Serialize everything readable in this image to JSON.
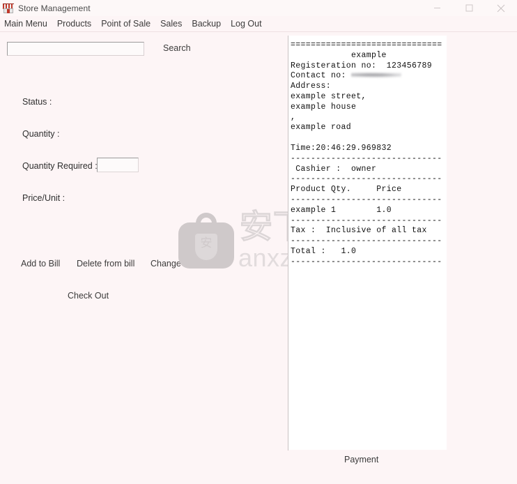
{
  "window": {
    "title": "Store Management",
    "icon": "store-icon",
    "controls": {
      "minimize": "minimize-icon",
      "maximize": "maximize-icon",
      "close": "close-icon"
    }
  },
  "menubar": {
    "items": [
      {
        "label": "Main Menu"
      },
      {
        "label": "Products"
      },
      {
        "label": "Point of Sale"
      },
      {
        "label": "Sales"
      },
      {
        "label": "Backup"
      },
      {
        "label": "Log Out"
      }
    ]
  },
  "form": {
    "search": {
      "value": "",
      "placeholder": ""
    },
    "search_button": "Search",
    "labels": {
      "status": "Status :",
      "quantity": "Quantity :",
      "quantity_required": "Quantity Required :",
      "price_unit": "Price/Unit :"
    },
    "values": {
      "status": "",
      "quantity": "",
      "price_unit": ""
    },
    "quantity_required_input": {
      "value": "",
      "placeholder": ""
    }
  },
  "buttons": {
    "add_to_bill": "Add to Bill",
    "delete_from_bill": "Delete from bill",
    "change": "Change",
    "check_out": "Check Out",
    "payment": "Payment"
  },
  "receipt": {
    "divider_equals": "==============================",
    "store_name": "example",
    "registration_line": "Registeration no:  123456789",
    "contact_label": "Contact no:",
    "contact_value_redacted": true,
    "address_label": "Address:",
    "address_lines": [
      "example street,",
      "example house",
      ",",
      "example road"
    ],
    "time_line": "Time:20:46:29.969832",
    "divider_dashes": "------------------------------",
    "cashier_line": " Cashier :  owner",
    "table_header": "Product Qty.     Price",
    "items": [
      {
        "line": "example 1        1.0"
      }
    ],
    "tax_line": "Tax :  Inclusive of all tax",
    "total_line": "Total :   1.0"
  },
  "watermark": {
    "bag_char": "安",
    "cn_text": "安下载",
    "domain": "anxz.com"
  },
  "colors": {
    "background": "#fdf5f6",
    "panel": "#ffffff",
    "text": "#2e2e2e",
    "border": "#9b9b9b",
    "accent_red": "#c0392b"
  }
}
